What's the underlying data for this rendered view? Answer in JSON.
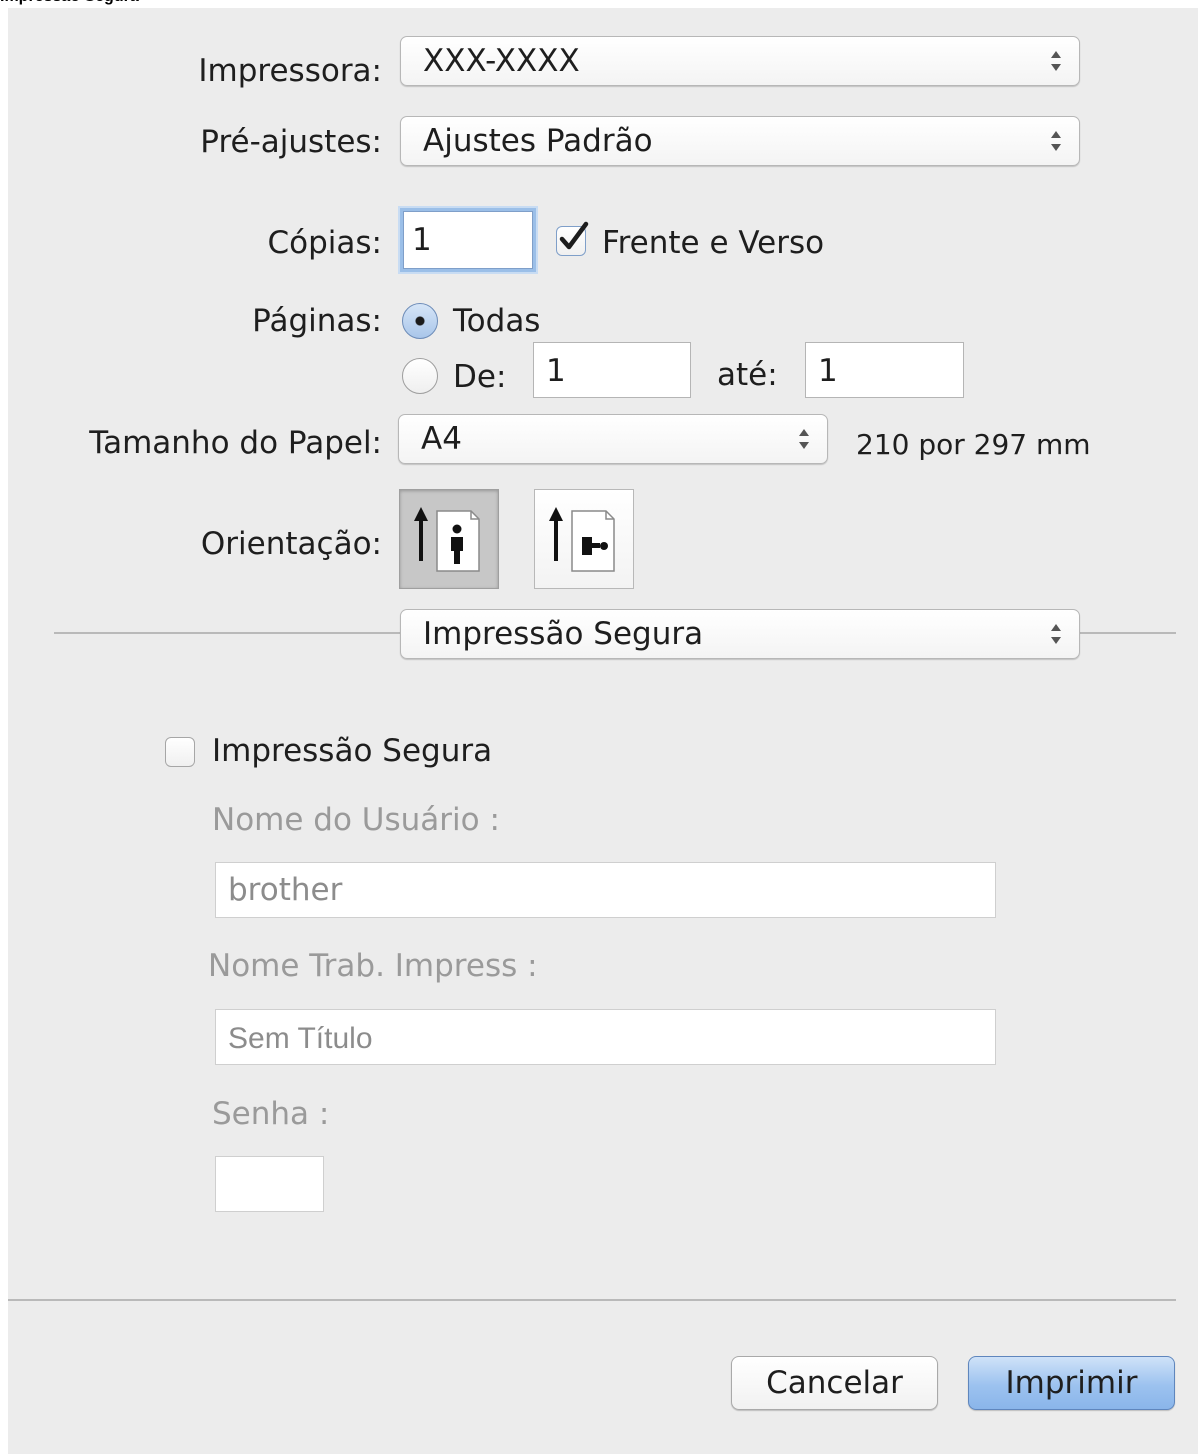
{
  "caption": "Impressão Segura",
  "printer": {
    "label": "Impressora:",
    "value": "XXX-XXXX"
  },
  "presets": {
    "label": "Pré-ajustes:",
    "value": "Ajustes Padrão"
  },
  "copies": {
    "label": "Cópias:",
    "value": "1",
    "duplex_label": "Frente e Verso",
    "duplex_checked": true
  },
  "pages": {
    "label": "Páginas:",
    "all_label": "Todas",
    "from_label": "De:",
    "from_value": "1",
    "to_label": "até:",
    "to_value": "1",
    "selected": "all"
  },
  "paper": {
    "label": "Tamanho do Papel:",
    "value": "A4",
    "dimensions": "210 por 297 mm"
  },
  "orientation": {
    "label": "Orientação:",
    "options": [
      {
        "name": "portrait",
        "icon": "portrait-orientation-icon",
        "selected": true
      },
      {
        "name": "landscape",
        "icon": "landscape-orientation-icon",
        "selected": false
      }
    ]
  },
  "section_popup": {
    "value": "Impressão Segura"
  },
  "secure": {
    "checkbox_label": "Impressão Segura",
    "checked": false,
    "username_label": "Nome do Usuário :",
    "username_value": "brother",
    "jobname_label": "Nome Trab. Impress :",
    "jobname_value": "Sem Título",
    "password_label": "Senha :",
    "password_value": ""
  },
  "buttons": {
    "cancel": "Cancelar",
    "print": "Imprimir"
  },
  "colors": {
    "panel_bg": "#ececec",
    "default_button": "#9cc2ef",
    "check": "#1c1c1c"
  }
}
